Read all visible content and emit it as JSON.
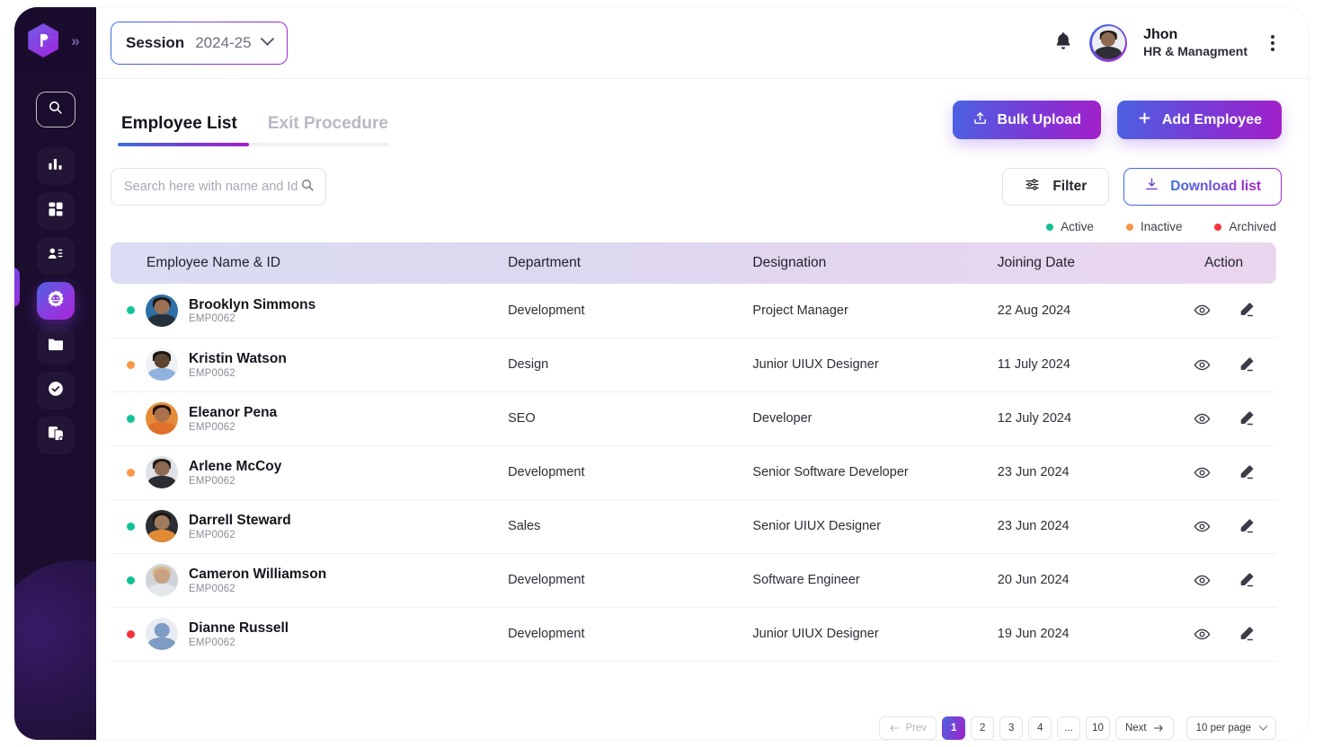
{
  "sidebar": {
    "logo_name": "app-logo",
    "expand_label": "»",
    "items": [
      {
        "name": "search",
        "icon": "search-icon"
      },
      {
        "name": "analytics",
        "icon": "bar-chart-icon"
      },
      {
        "name": "dashboard",
        "icon": "grid-icon"
      },
      {
        "name": "contacts",
        "icon": "user-list-icon"
      },
      {
        "name": "employees",
        "icon": "badge-gear-icon",
        "active": true
      },
      {
        "name": "files",
        "icon": "folder-icon"
      },
      {
        "name": "approvals",
        "icon": "check-circle-icon"
      },
      {
        "name": "reports",
        "icon": "documents-icon"
      }
    ]
  },
  "header": {
    "session_label": "Session",
    "session_value": "2024-25",
    "notification_icon": "bell-icon",
    "user": {
      "name": "Jhon",
      "role": "HR & Managment"
    },
    "menu_icon": "kebab-menu-icon"
  },
  "tabs": [
    {
      "label": "Employee List",
      "active": true
    },
    {
      "label": "Exit Procedure",
      "active": false
    }
  ],
  "actions": {
    "bulk_upload": "Bulk Upload",
    "add_employee": "Add Employee",
    "filter": "Filter",
    "download_list": "Download list"
  },
  "search": {
    "placeholder": "Search here with name and Id",
    "value": ""
  },
  "legend": [
    {
      "label": "Active",
      "color": "#13c296"
    },
    {
      "label": "Inactive",
      "color": "#f99746"
    },
    {
      "label": "Archived",
      "color": "#f5333f"
    }
  ],
  "table": {
    "columns": [
      "Employee Name & ID",
      "Department",
      "Designation",
      "Joining Date",
      "Action"
    ],
    "rows": [
      {
        "status": "active",
        "name": "Brooklyn Simmons",
        "id": "EMP0062",
        "department": "Development",
        "designation": "Project Manager",
        "joining_date": "22 Aug 2024"
      },
      {
        "status": "inactive",
        "name": "Kristin Watson",
        "id": "EMP0062",
        "department": "Design",
        "designation": "Junior UIUX Designer",
        "joining_date": "11 July 2024"
      },
      {
        "status": "active",
        "name": "Eleanor Pena",
        "id": "EMP0062",
        "department": "SEO",
        "designation": "Developer",
        "joining_date": "12 July 2024"
      },
      {
        "status": "inactive",
        "name": "Arlene McCoy",
        "id": "EMP0062",
        "department": "Development",
        "designation": "Senior Software Developer",
        "joining_date": "23 Jun 2024"
      },
      {
        "status": "active",
        "name": "Darrell Steward",
        "id": "EMP0062",
        "department": "Sales",
        "designation": "Senior UIUX Designer",
        "joining_date": "23 Jun 2024"
      },
      {
        "status": "active",
        "name": "Cameron Williamson",
        "id": "EMP0062",
        "department": "Development",
        "designation": "Software Engineer",
        "joining_date": "20 Jun 2024"
      },
      {
        "status": "archived",
        "name": "Dianne Russell",
        "id": "EMP0062",
        "department": "Development",
        "designation": "Junior UIUX Designer",
        "joining_date": "19 Jun 2024"
      }
    ],
    "row_action_icons": [
      "eye-icon",
      "pencil-icon"
    ]
  },
  "pagination": {
    "prev_label": "Prev",
    "next_label": "Next",
    "pages": [
      "1",
      "2",
      "3",
      "4",
      "...",
      "10"
    ],
    "current_page": "1",
    "per_page_label": "10 per page"
  },
  "colors": {
    "active": "#13c296",
    "inactive": "#f99746",
    "archived": "#f5333f",
    "gradient_start": "#3b6fe0",
    "gradient_end": "#a726cf",
    "sidebar_bg": "#1b0d2e"
  }
}
